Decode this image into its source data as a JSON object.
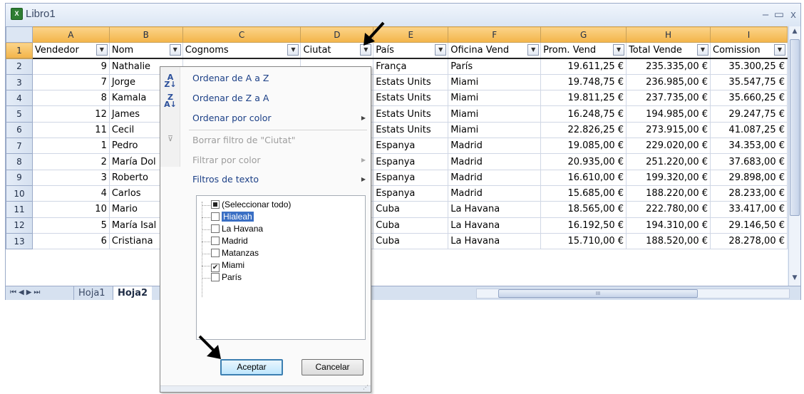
{
  "window": {
    "title": "Libro1",
    "app_icon": "excel-icon"
  },
  "columns": [
    "A",
    "B",
    "C",
    "D",
    "E",
    "F",
    "G",
    "H",
    "I"
  ],
  "header_row": {
    "row_number": "1",
    "cells": [
      "Vendedor",
      "Nom",
      "Cognoms",
      "Ciutat",
      "País",
      "Oficina Vend",
      "Prom. Vend",
      "Total Vende",
      "Comission"
    ]
  },
  "rows": [
    {
      "n": "2",
      "a": "9",
      "b": "Nathalie",
      "e": "França",
      "f": "París",
      "g": "19.611,25 €",
      "h": "235.335,00 €",
      "i": "35.300,25 €"
    },
    {
      "n": "3",
      "a": "7",
      "b": "Jorge",
      "e": "Estats Units",
      "f": "Miami",
      "g": "19.748,75 €",
      "h": "236.985,00 €",
      "i": "35.547,75 €"
    },
    {
      "n": "4",
      "a": "8",
      "b": "Kamala",
      "e": "Estats Units",
      "f": "Miami",
      "g": "19.811,25 €",
      "h": "237.735,00 €",
      "i": "35.660,25 €"
    },
    {
      "n": "5",
      "a": "12",
      "b": "James",
      "e": "Estats Units",
      "f": "Miami",
      "g": "16.248,75 €",
      "h": "194.985,00 €",
      "i": "29.247,75 €"
    },
    {
      "n": "6",
      "a": "11",
      "b": "Cecil",
      "e": "Estats Units",
      "f": "Miami",
      "g": "22.826,25 €",
      "h": "273.915,00 €",
      "i": "41.087,25 €"
    },
    {
      "n": "7",
      "a": "1",
      "b": "Pedro",
      "e": "Espanya",
      "f": "Madrid",
      "g": "19.085,00 €",
      "h": "229.020,00 €",
      "i": "34.353,00 €"
    },
    {
      "n": "8",
      "a": "2",
      "b": "María Dol",
      "e": "Espanya",
      "f": "Madrid",
      "g": "20.935,00 €",
      "h": "251.220,00 €",
      "i": "37.683,00 €"
    },
    {
      "n": "9",
      "a": "3",
      "b": "Roberto",
      "e": "Espanya",
      "f": "Madrid",
      "g": "16.610,00 €",
      "h": "199.320,00 €",
      "i": "29.898,00 €"
    },
    {
      "n": "10",
      "a": "4",
      "b": "Carlos",
      "e": "Espanya",
      "f": "Madrid",
      "g": "15.685,00 €",
      "h": "188.220,00 €",
      "i": "28.233,00 €"
    },
    {
      "n": "11",
      "a": "10",
      "b": "Mario",
      "e": "Cuba",
      "f": "La Havana",
      "g": "18.565,00 €",
      "h": "222.780,00 €",
      "i": "33.417,00 €"
    },
    {
      "n": "12",
      "a": "5",
      "b": "María Isal",
      "e": "Cuba",
      "f": "La Havana",
      "g": "16.192,50 €",
      "h": "194.310,00 €",
      "i": "29.146,50 €"
    },
    {
      "n": "13",
      "a": "6",
      "b": "Cristiana",
      "e": "Cuba",
      "f": "La Havana",
      "g": "15.710,00 €",
      "h": "188.520,00 €",
      "i": "28.278,00 €"
    }
  ],
  "sheet_tabs": [
    "Hoja1",
    "Hoja2"
  ],
  "active_sheet": "Hoja2",
  "filter_menu": {
    "sort_az": "Ordenar de A a Z",
    "sort_za": "Ordenar de Z a A",
    "sort_color": "Ordenar por color",
    "clear_filter": "Borrar filtro de \"Ciutat\"",
    "filter_color": "Filtrar por color",
    "text_filters": "Filtros de texto",
    "values": [
      {
        "label": "(Seleccionar todo)",
        "state": "partial"
      },
      {
        "label": "Hialeah",
        "state": "unchecked",
        "focused": true
      },
      {
        "label": "La Havana",
        "state": "unchecked"
      },
      {
        "label": "Madrid",
        "state": "unchecked"
      },
      {
        "label": "Matanzas",
        "state": "unchecked"
      },
      {
        "label": "Miami",
        "state": "checked"
      },
      {
        "label": "París",
        "state": "unchecked"
      }
    ],
    "ok_button": "Aceptar",
    "cancel_button": "Cancelar"
  },
  "colors": {
    "header_orange": "#f3b449",
    "menu_text": "#1b3f86",
    "frame": "#9aaac8"
  }
}
